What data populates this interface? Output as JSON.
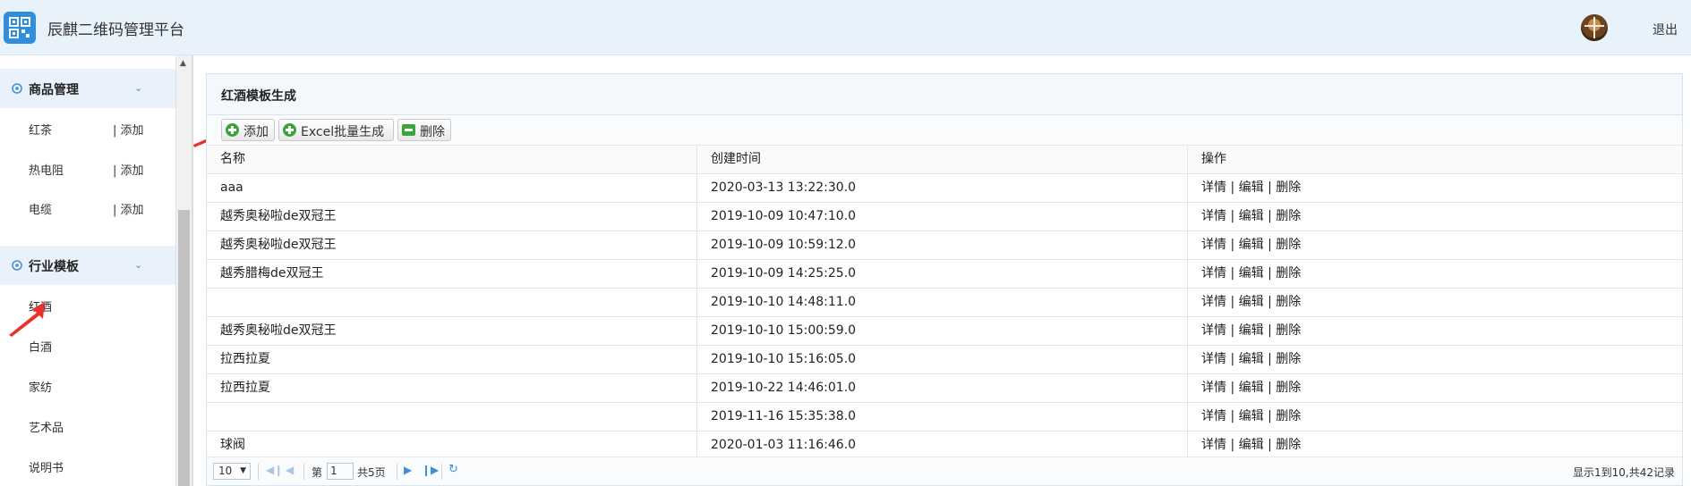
{
  "header": {
    "title": "辰麒二维码管理平台",
    "logout": "退出"
  },
  "sidebar": {
    "groups": [
      {
        "label": "商品管理",
        "icon": "gear-icon",
        "items": [
          {
            "label": "红茶",
            "add": "| 添加"
          },
          {
            "label": "热电阻",
            "add": "| 添加"
          },
          {
            "label": "电缆",
            "add": "| 添加"
          }
        ]
      },
      {
        "label": "行业模板",
        "icon": "gear-icon",
        "items": [
          {
            "label": "红酒"
          },
          {
            "label": "白酒"
          },
          {
            "label": "家纺"
          },
          {
            "label": "艺术品"
          },
          {
            "label": "说明书"
          }
        ]
      }
    ]
  },
  "panel": {
    "title": "红酒模板生成",
    "toolbar": {
      "add": "添加",
      "excel": "Excel批量生成",
      "delete": "删除"
    },
    "table": {
      "columns": [
        "名称",
        "创建时间",
        "操作"
      ],
      "rows": [
        {
          "name": "aaa",
          "time": "2020-03-13 13:22:30.0"
        },
        {
          "name": "越秀奥秘啦de双冠王",
          "time": "2019-10-09 10:47:10.0"
        },
        {
          "name": "越秀奥秘啦de双冠王",
          "time": "2019-10-09 10:59:12.0"
        },
        {
          "name": "越秀腊梅de双冠王",
          "time": "2019-10-09 14:25:25.0"
        },
        {
          "name": "",
          "time": "2019-10-10 14:48:11.0"
        },
        {
          "name": "越秀奥秘啦de双冠王",
          "time": "2019-10-10 15:00:59.0"
        },
        {
          "name": "拉西拉夏",
          "time": "2019-10-10 15:16:05.0"
        },
        {
          "name": "拉西拉夏",
          "time": "2019-10-22 14:46:01.0"
        },
        {
          "name": "",
          "time": "2019-11-16 15:35:38.0"
        },
        {
          "name": "球阀",
          "time": "2020-01-03 11:16:46.0"
        }
      ],
      "actions": {
        "detail": "详情",
        "edit": "编辑",
        "delete": "删除",
        "sep": "|"
      }
    },
    "pager": {
      "page_size": "10",
      "page_prefix": "第",
      "page_value": "1",
      "page_total": "共5页",
      "info": "显示1到10,共42记录"
    }
  },
  "colors": {
    "header_bg": "#e8f2fb",
    "accent": "#2f8fdc",
    "annotation_arrow": "#e8322b"
  }
}
